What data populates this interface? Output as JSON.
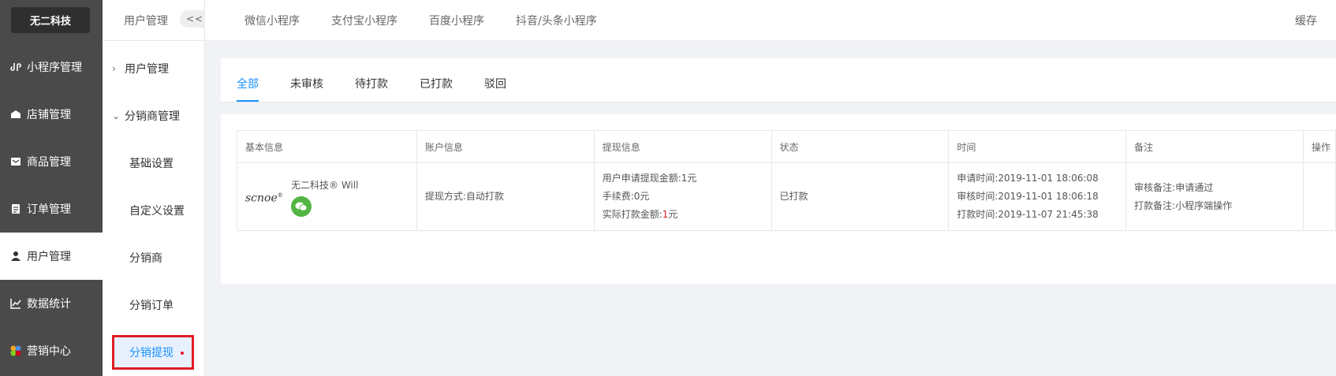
{
  "sidebar": {
    "brand": "无二科技",
    "items": [
      {
        "label": "小程序管理",
        "icon": "mini-program-icon"
      },
      {
        "label": "店铺管理",
        "icon": "store-icon"
      },
      {
        "label": "商品管理",
        "icon": "goods-icon"
      },
      {
        "label": "订单管理",
        "icon": "order-icon"
      },
      {
        "label": "用户管理",
        "icon": "user-icon"
      },
      {
        "label": "数据统计",
        "icon": "chart-icon"
      },
      {
        "label": "营销中心",
        "icon": "marketing-icon"
      }
    ]
  },
  "subnav": {
    "title": "用户管理",
    "collapse": "<<",
    "groups": [
      "用户管理",
      "分销商管理"
    ],
    "items": [
      "基础设置",
      "自定义设置",
      "分销商",
      "分销订单",
      "分销提现"
    ]
  },
  "topbar": {
    "tabs": [
      "微信小程序",
      "支付宝小程序",
      "百度小程序",
      "抖音/头条小程序"
    ],
    "right": "缓存"
  },
  "status_tabs": [
    "全部",
    "未审核",
    "待打款",
    "已打款",
    "驳回"
  ],
  "table": {
    "headers": [
      "基本信息",
      "账户信息",
      "提现信息",
      "状态",
      "时间",
      "备注",
      "操作"
    ],
    "row": {
      "logo": "scnoe",
      "logo_mark": "®",
      "user": "无二科技® Will",
      "account": "提现方式:自动打款",
      "apply_amount": "用户申请提现金额:1元",
      "fee": "手续费:0元",
      "actual_label": "实际打款金额:",
      "actual_value": "1",
      "actual_unit": "元",
      "status": "已打款",
      "apply_time": "申请时间:2019-11-01 18:06:08",
      "review_time": "审核时间:2019-11-01 18:06:18",
      "pay_time": "打款时间:2019-11-07 21:45:38",
      "review_note": "审核备注:申请通过",
      "pay_note": "打款备注:小程序端操作",
      "op": ""
    }
  },
  "colors": {
    "accent": "#1890ff",
    "sidebar_bg": "#4a4a4a",
    "highlight": "#e01b24",
    "wechat": "#52b543"
  }
}
